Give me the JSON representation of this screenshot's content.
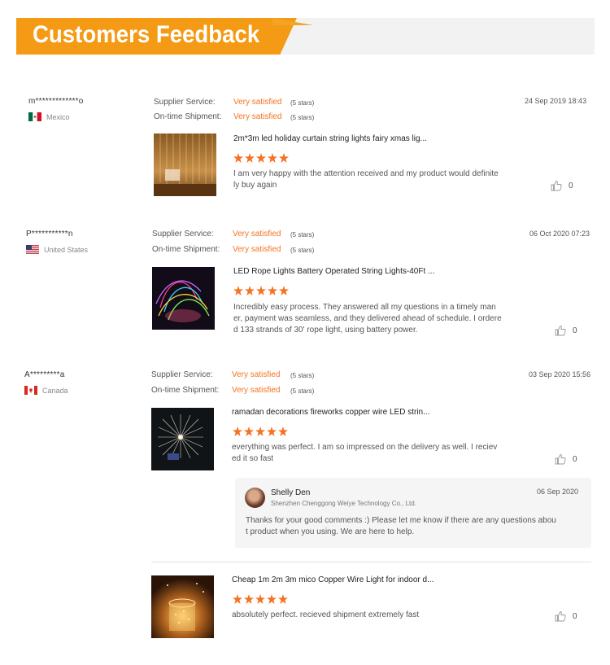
{
  "header": {
    "title": "Customers Feedback"
  },
  "labels": {
    "supplier_service": "Supplier Service:",
    "ontime_shipment": "On-time Shipment:"
  },
  "reviews": [
    {
      "user": "m*************o",
      "country": "Mexico",
      "flag": "mexico-flag-icon",
      "supplier_rating": "Very satisfied",
      "supplier_stars": "(5 stars)",
      "shipment_rating": "Very satisfied",
      "shipment_stars": "(5 stars)",
      "date": "24 Sep 2019 18:43",
      "product_title": "2m*3m led holiday curtain string lights fairy xmas lig...",
      "rating": 5,
      "text": "I am very happy with the attention received and my product would definitely buy again",
      "text_lines": [
        "I am very happy with the attention received and my product would definite",
        "ly buy again"
      ],
      "likes": "0"
    },
    {
      "user": "P***********n",
      "country": "United States",
      "flag": "usa-flag-icon",
      "supplier_rating": "Very satisfied",
      "supplier_stars": "(5 stars)",
      "shipment_rating": "Very satisfied",
      "shipment_stars": "(5 stars)",
      "date": "06 Oct 2020 07:23",
      "product_title": "LED Rope Lights Battery Operated String Lights-40Ft ...",
      "rating": 5,
      "text_lines": [
        "Incredibly easy process. They answered all my questions in a timely man",
        "er, payment was seamless, and they delivered ahead of schedule. I ordere",
        "d 133 strands of 30' rope light, using battery power."
      ],
      "likes": "0"
    },
    {
      "user": "A*********a",
      "country": "Canada",
      "flag": "canada-flag-icon",
      "supplier_rating": "Very satisfied",
      "supplier_stars": "(5 stars)",
      "shipment_rating": "Very satisfied",
      "shipment_stars": "(5 stars)",
      "date": "03 Sep 2020 15:56",
      "product_title": "ramadan decorations fireworks copper wire LED strin...",
      "rating": 5,
      "text_lines": [
        "everything was perfect. I am so impressed on the delivery as well. I reciev",
        "ed it so fast"
      ],
      "likes": "0",
      "reply": {
        "name": "Shelly Den",
        "company": "Shenzhen Chenggong Weiye Technology Co., Ltd.",
        "date": "06 Sep 2020",
        "text_lines": [
          "Thanks for your good comments :) Please let me know if there are any questions abou",
          "t product when you using. We are here to help."
        ]
      },
      "second_item": {
        "product_title": "Cheap 1m 2m 3m mico Copper Wire Light for indoor d...",
        "rating": 5,
        "text": "absolutely perfect. recieved shipment extremely fast",
        "likes": "0"
      }
    }
  ],
  "colors": {
    "accent": "#f47322",
    "banner": "#f49a14"
  }
}
